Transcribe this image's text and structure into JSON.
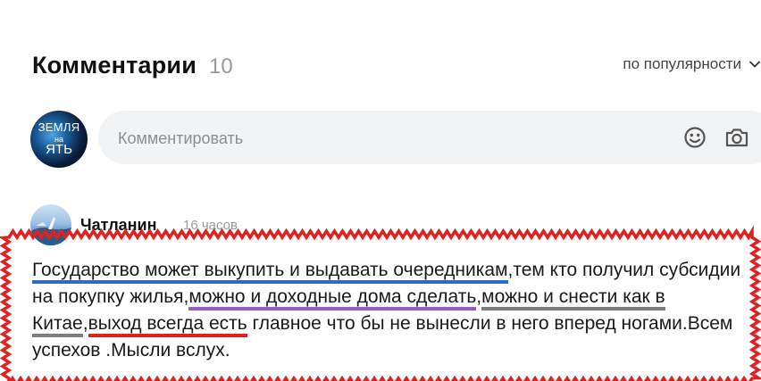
{
  "comments_section": {
    "title": "Комментарии",
    "count": "10",
    "sort_label": "по популярности"
  },
  "composer": {
    "avatar_text_top": "ЗЕМЛЯ",
    "avatar_text_mid": "на",
    "avatar_text_bottom": "ЯТЬ",
    "placeholder": "Комментировать",
    "icons": [
      "emoji-icon",
      "camera-icon",
      "chevron-down-icon"
    ]
  },
  "comment": {
    "author": "Чатланин",
    "time": "16 часов",
    "seg1": "Государство может выкупить и выдавать очередникам",
    "seg2": ",тем кто получил субсидии на покупку жилья,",
    "seg3": "можно и доходные дома сделать",
    "seg4": ",",
    "seg5": "можно и снести как в Китае",
    "seg6": ",",
    "seg7": "выход всегда есть",
    "seg8": " главное что бы не вынесли в него вперед ногами.Всем успехов .Мысли вслух."
  },
  "annotation_colors": {
    "frame": "#e0211f",
    "blue": "#2e6cc0",
    "purple": "#9b5dbf",
    "gray": "#7d7d7d",
    "red": "#e0211f"
  }
}
